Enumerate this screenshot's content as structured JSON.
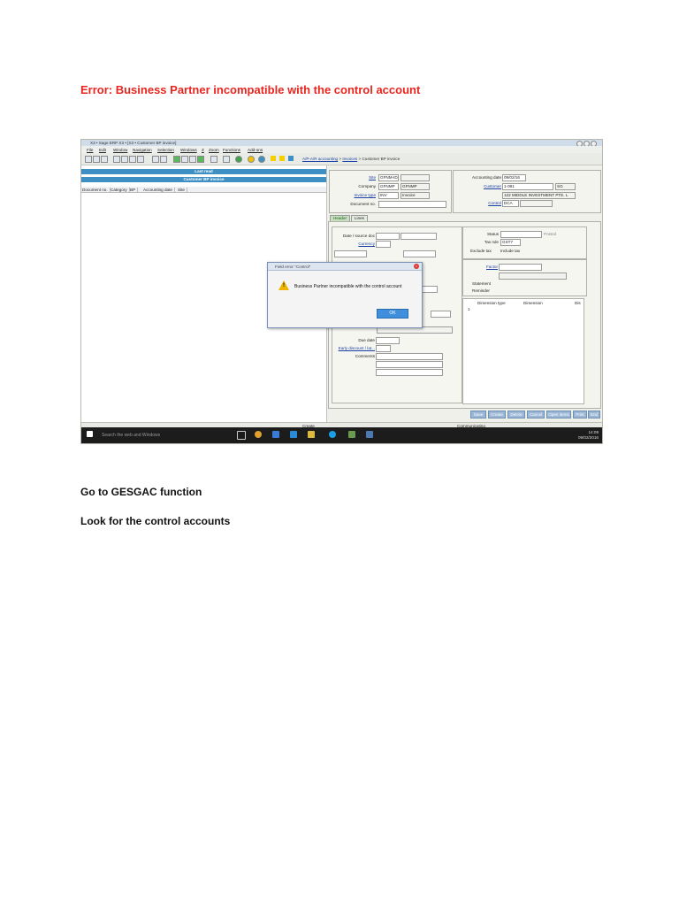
{
  "heading": "Error: Business Partner incompatible with the control account",
  "steps": [
    "Go to GESGAC function",
    "Look for the control accounts"
  ],
  "screenshot": {
    "window_title": "X3 • Sage ERP X3 • [X3 • Customer BP invoice]",
    "menu": [
      "File",
      "Edit",
      "Window",
      "Navigation",
      "Selection",
      "Windows",
      "Z",
      "Zoom",
      "Functions",
      "Add-ons"
    ],
    "breadcrumb": [
      "A/P-A/R accounting",
      "Invoices",
      "Customer BP invoice"
    ],
    "left_panel": {
      "last_read": "Last read",
      "list_title": "Customer BP invoice",
      "columns": [
        "Document no.",
        "Category",
        "BP",
        "Accounting date",
        "Site"
      ]
    },
    "header_form": {
      "site_label": "Site",
      "site_value": "GFNM-ID",
      "company_label": "Company",
      "company_value": "GFNMP",
      "company_desc": "GFNMP",
      "invoice_type_label": "Invoice type",
      "invoice_type_value": "INV",
      "invoice_type_desc": "Invoice",
      "document_no_label": "Document no.",
      "accounting_date_label": "Accounting date",
      "accounting_date_value": "09/02/16",
      "customer_label": "Customer",
      "customer_value": "1-081",
      "customer_country": "SG",
      "customer_name": "122 MIDDLE INVESTMENT PTE. L",
      "control_label": "Control",
      "control_value": "DCA"
    },
    "tabs": [
      "Header",
      "Lines"
    ],
    "form": {
      "date_source_label": "Date / source doc",
      "currency_label": "Currency",
      "status_label": "Status",
      "posted_label": "Posted",
      "tax_rule_label": "Tax rule",
      "tax_rule_value": "GST7",
      "exclude_tax_label": "Exclude tax",
      "include_tax_label": "Include tax",
      "factor_label": "Factor",
      "statement_label": "Statement",
      "reminder_label": "Reminder",
      "due_date_label": "Due date",
      "early_discount_label": "Early discount / lat...",
      "comments_label": "Comments"
    },
    "grid": {
      "columns": [
        "Dimension type",
        "Dimension",
        "Dis"
      ],
      "row_number": "1"
    },
    "buttons": [
      "Save",
      "Create",
      "Delete",
      "Cancel",
      "Open items",
      "Print",
      "End"
    ],
    "status_bar": {
      "mode": "Create",
      "state": "Communicating"
    },
    "taskbar": {
      "search_placeholder": "Search the web and Windows",
      "time": "14:08",
      "date": "09/02/2016"
    },
    "dialog": {
      "title": "Field error \"Control\"",
      "message": "Business Partner incompatible with the control account",
      "ok_label": "OK"
    }
  }
}
